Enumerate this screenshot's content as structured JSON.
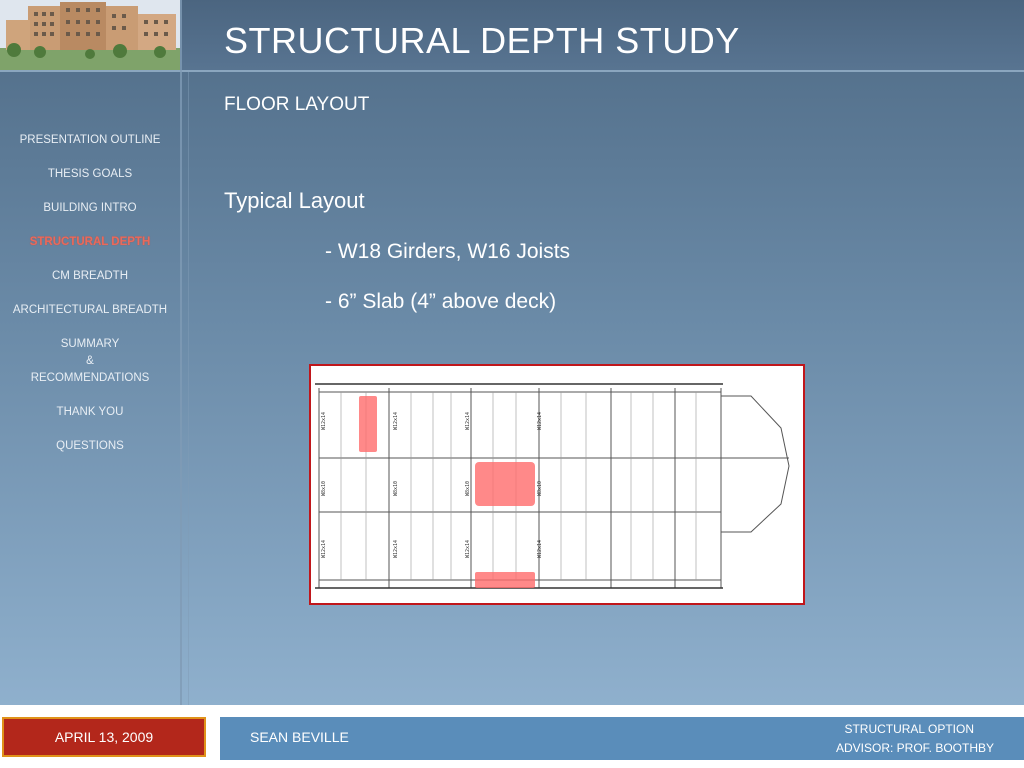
{
  "slide": {
    "title": "STRUCTURAL DEPTH STUDY",
    "subtitle": "FLOOR LAYOUT"
  },
  "nav": {
    "items": [
      {
        "label": "PRESENTATION OUTLINE"
      },
      {
        "label": "THESIS GOALS"
      },
      {
        "label": "BUILDING INTRO"
      },
      {
        "label": "STRUCTURAL DEPTH",
        "active": true
      },
      {
        "label": "CM BREADTH"
      },
      {
        "label": "ARCHITECTURAL BREADTH"
      },
      {
        "label": "SUMMARY",
        "line2": "&",
        "line3": "RECOMMENDATIONS"
      },
      {
        "label": "THANK YOU"
      },
      {
        "label": "QUESTIONS"
      }
    ]
  },
  "content": {
    "heading": "Typical Layout",
    "bullets": [
      "- W18 Girders, W16 Joists",
      "- 6” Slab (4” above deck)"
    ]
  },
  "plan": {
    "joist_labels": [
      "W12x14",
      "W12x14",
      "W12x14",
      "W12x14",
      "W8x10",
      "W8x10",
      "W8x10",
      "W8x10",
      "W12x14",
      "W12x14",
      "W12x14",
      "W12x14"
    ]
  },
  "footer": {
    "date": "APRIL 13, 2009",
    "name": "SEAN BEVILLE",
    "option": "STRUCTURAL OPTION",
    "advisor": "ADVISOR:  PROF. BOOTHBY"
  },
  "colors": {
    "accent": "#b3271b",
    "footer_bar": "#5a8dba",
    "active_nav": "#e86a5c",
    "highlight": "#ff6b6b"
  }
}
